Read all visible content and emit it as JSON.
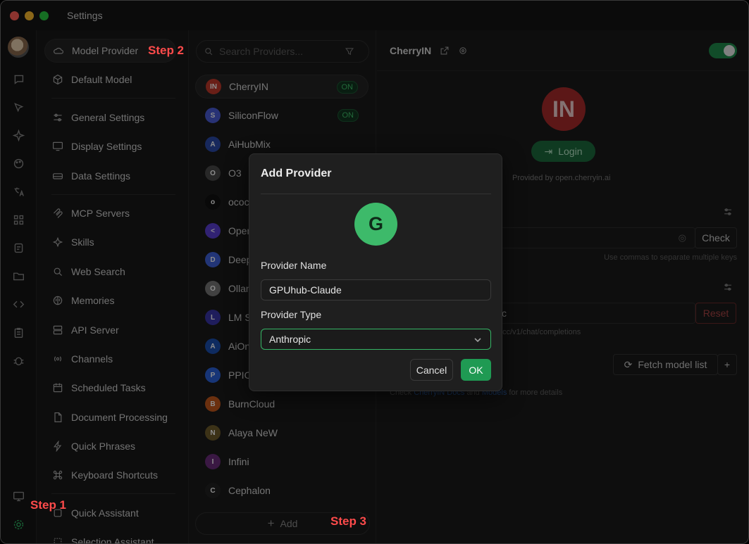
{
  "window": {
    "title": "Settings"
  },
  "steps": {
    "step1": "Step 1",
    "step2": "Step 2",
    "step3": "Step 3"
  },
  "settings_nav": [
    {
      "label": "Model Provider",
      "icon": "cloud-icon",
      "active": true
    },
    {
      "label": "Default Model",
      "icon": "cube-icon"
    },
    {
      "label": "General Settings",
      "icon": "sliders-icon"
    },
    {
      "label": "Display Settings",
      "icon": "monitor-icon"
    },
    {
      "label": "Data Settings",
      "icon": "database-icon"
    },
    {
      "label": "MCP Servers",
      "icon": "mcp-icon"
    },
    {
      "label": "Skills",
      "icon": "sparkle-icon"
    },
    {
      "label": "Web Search",
      "icon": "search-icon"
    },
    {
      "label": "Memories",
      "icon": "brain-icon"
    },
    {
      "label": "API Server",
      "icon": "server-icon"
    },
    {
      "label": "Channels",
      "icon": "broadcast-icon"
    },
    {
      "label": "Scheduled Tasks",
      "icon": "calendar-icon"
    },
    {
      "label": "Document Processing",
      "icon": "document-icon"
    },
    {
      "label": "Quick Phrases",
      "icon": "bolt-icon"
    },
    {
      "label": "Keyboard Shortcuts",
      "icon": "command-icon"
    },
    {
      "label": "Quick Assistant",
      "icon": "assistant-icon"
    },
    {
      "label": "Selection Assistant",
      "icon": "selection-icon"
    }
  ],
  "providers": {
    "search_placeholder": "Search Providers...",
    "on_label": "ON",
    "add_label": "Add",
    "items": [
      {
        "name": "CherryIN",
        "logo_text": "IN",
        "logo_color": "#c0392b",
        "on": true
      },
      {
        "name": "SiliconFlow",
        "logo_text": "S",
        "logo_color": "#4a5bd6",
        "on": true
      },
      {
        "name": "AiHubMix",
        "logo_text": "A",
        "logo_color": "#2b4aa8"
      },
      {
        "name": "O3",
        "logo_text": "O",
        "logo_color": "#4a4a4a"
      },
      {
        "name": "ococ",
        "logo_text": "o",
        "logo_color": "#111111"
      },
      {
        "name": "Open",
        "logo_text": "<",
        "logo_color": "#5a3fd1"
      },
      {
        "name": "Deep",
        "logo_text": "D",
        "logo_color": "#3f62d9"
      },
      {
        "name": "Ollan",
        "logo_text": "O",
        "logo_color": "#777777"
      },
      {
        "name": "LM S",
        "logo_text": "L",
        "logo_color": "#3a35a8"
      },
      {
        "name": "AiOn",
        "logo_text": "A",
        "logo_color": "#1a4fb0"
      },
      {
        "name": "PPIO",
        "logo_text": "P",
        "logo_color": "#2a62d9"
      },
      {
        "name": "BurnCloud",
        "logo_text": "B",
        "logo_color": "#c4581d"
      },
      {
        "name": "Alaya NeW",
        "logo_text": "N",
        "logo_color": "#6d5c2a"
      },
      {
        "name": "Infini",
        "logo_text": "I",
        "logo_color": "#6a2c7a"
      },
      {
        "name": "Cephalon",
        "logo_text": "C",
        "logo_color": "#222222"
      }
    ]
  },
  "detail": {
    "title": "CherryIN",
    "logo_text": "IN",
    "login_label": "Login",
    "provided_by": "Provided by  open.cherryin.ai",
    "check_label": "Check",
    "keys_hint": "Use commas to separate multiple keys",
    "api_partial": "c",
    "reset_label": "Reset",
    "endpoint_hint": "cc/v1/chat/completions",
    "fetch_label": "Fetch model list",
    "plus_label": "+",
    "docs_hint_prefix": "Check",
    "docs_link": "CherryIN Docs",
    "docs_and": "and",
    "models_link": "Models",
    "docs_suffix": "for more details"
  },
  "modal": {
    "title": "Add Provider",
    "avatar_letter": "G",
    "name_label": "Provider Name",
    "name_value": "GPUhub-Claude",
    "type_label": "Provider Type",
    "type_value": "Anthropic",
    "cancel_label": "Cancel",
    "ok_label": "OK"
  },
  "colors": {
    "accent": "#1f9a53",
    "step": "#ff4b4b",
    "background": "#1b1b1b"
  }
}
